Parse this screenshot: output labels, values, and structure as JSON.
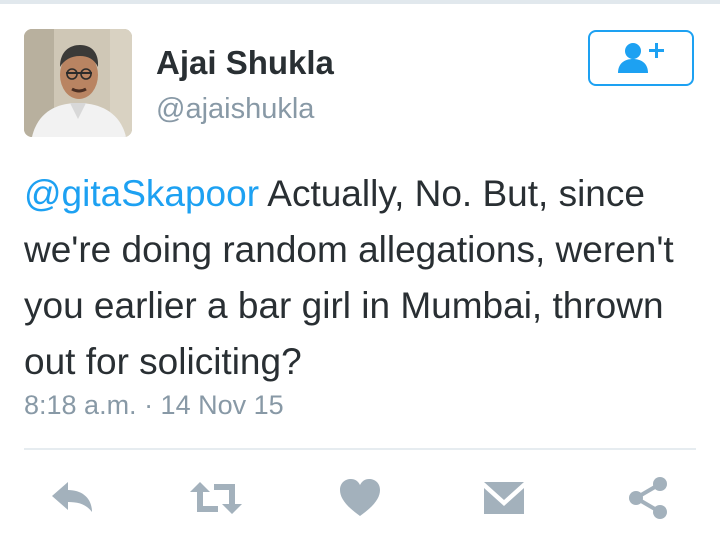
{
  "user": {
    "display_name": "Ajai Shukla",
    "handle": "@ajaishukla"
  },
  "tweet": {
    "mention": "@gitaSkapoor",
    "body": " Actually, No. But, since we're doing random allegations, weren't you earlier a bar girl in Mumbai, thrown out for soliciting?",
    "timestamp": "8:18 a.m. · 14 Nov 15"
  },
  "icons": {
    "follow": "follow-user-icon",
    "reply": "reply-icon",
    "retweet": "retweet-icon",
    "like": "heart-icon",
    "message": "envelope-icon",
    "share": "share-icon"
  },
  "colors": {
    "accent": "#1da1f2",
    "text": "#292f33",
    "muted": "#8899a6",
    "action_icon": "#a3b1bc"
  }
}
